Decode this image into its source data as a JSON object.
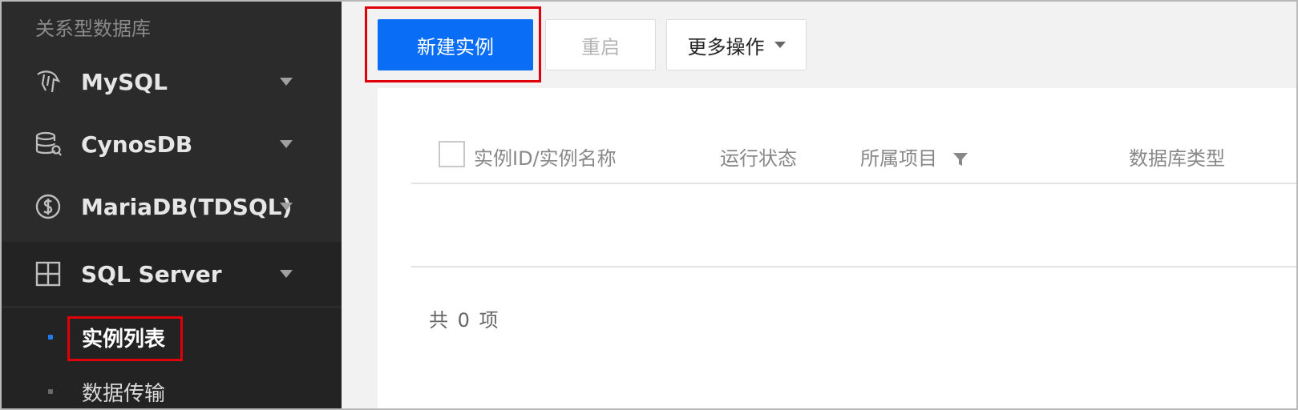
{
  "sidebar": {
    "section_title": "关系型数据库",
    "items": [
      {
        "label": "MySQL",
        "icon": "dolphin-icon"
      },
      {
        "label": "CynosDB",
        "icon": "database-icon"
      },
      {
        "label": "MariaDB(TDSQL)",
        "icon": "dollar-circle-icon"
      },
      {
        "label": "SQL Server",
        "icon": "grid-icon"
      }
    ],
    "sub_items": [
      {
        "label": "实例列表",
        "active": true
      },
      {
        "label": "数据传输",
        "active": false
      }
    ]
  },
  "toolbar": {
    "create_label": "新建实例",
    "restart_label": "重启",
    "more_label": "更多操作"
  },
  "table": {
    "columns": [
      "实例ID/实例名称",
      "运行状态",
      "所属项目",
      "数据库类型"
    ],
    "total_label": "共 0 项"
  },
  "colors": {
    "primary": "#0a6df6",
    "sidebar_bg": "#2b2b2b",
    "highlight": "#e0000a"
  }
}
